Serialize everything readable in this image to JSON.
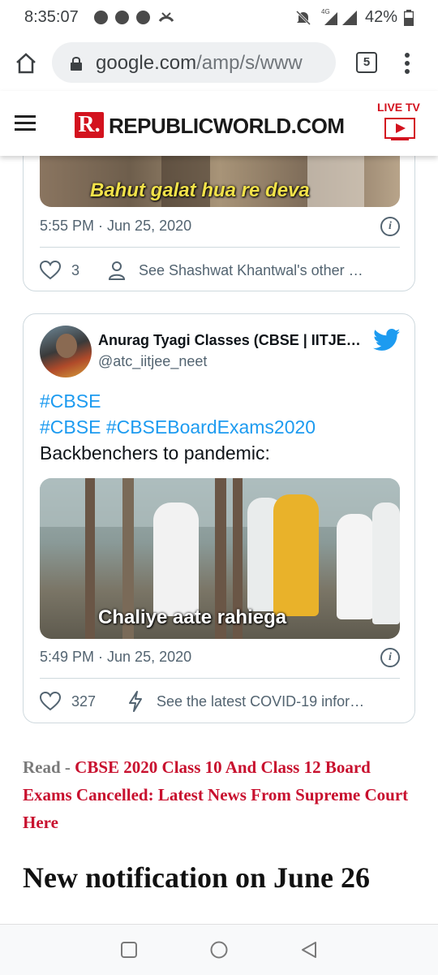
{
  "status_bar": {
    "time": "8:35:07",
    "network": "4G",
    "battery": "42%"
  },
  "browser": {
    "url_domain": "google.com",
    "url_path": "/amp/s/www",
    "tab_count": "5"
  },
  "site_header": {
    "logo_letter": "R.",
    "logo_name": "REPUBLICWORLD.COM",
    "live_label": "LIVE TV"
  },
  "tweet1": {
    "media_caption": "Bahut galat hua re deva",
    "timestamp": "5:55 PM · Jun 25, 2020",
    "likes": "3",
    "other_action": "See Shashwat Khantwal's other …"
  },
  "tweet2": {
    "author_name": "Anurag Tyagi Classes (CBSE | IITJE…",
    "handle": "@atc_iitjee_neet",
    "hashtag_line1": "#CBSE",
    "hashtag_line2": "#CBSE #CBSEBoardExams2020",
    "body": "Backbenchers to pandemic:",
    "media_caption": "Chaliye aate rahiega",
    "timestamp": "5:49 PM · Jun 25, 2020",
    "likes": "327",
    "other_action": "See the latest COVID-19 infor…"
  },
  "article": {
    "read_label": "Read -",
    "read_link": "CBSE 2020 Class 10 And Class 12 Board Exams Cancelled: Latest News From Supreme Court Here",
    "heading": "New notification on June 26"
  },
  "icons": {
    "status": [
      "chat-icon",
      "messages-icon",
      "phone-icon",
      "missed-call-icon",
      "mute-icon",
      "signal-icon",
      "battery-icon"
    ],
    "browser": [
      "home-icon",
      "lock-icon",
      "tabs-icon",
      "more-icon"
    ],
    "tweet": [
      "heart-icon",
      "person-icon",
      "bolt-icon",
      "info-icon",
      "twitter-bird-icon"
    ],
    "nav": [
      "recents-icon",
      "home-circle-icon",
      "back-icon"
    ]
  },
  "colors": {
    "brand_red": "#d3121e",
    "twitter_blue": "#1d9bf0",
    "link_red": "#c8102e"
  }
}
